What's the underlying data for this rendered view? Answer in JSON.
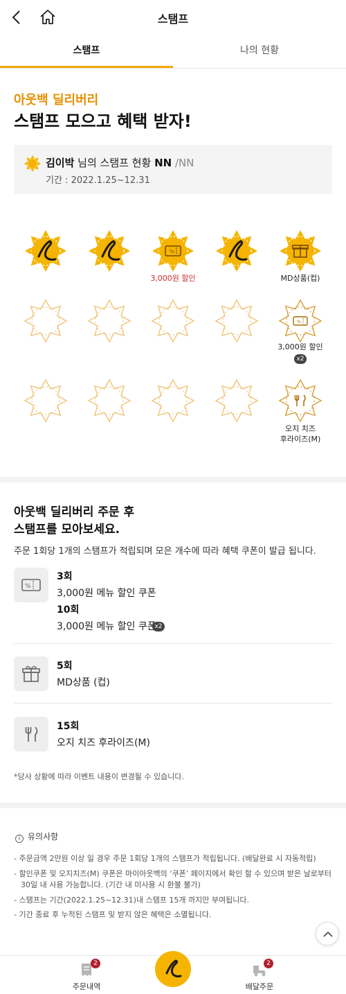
{
  "header": {
    "title": "스탬프"
  },
  "tabs": [
    {
      "label": "스탬프"
    },
    {
      "label": "나의 현황"
    }
  ],
  "hero": {
    "subtitle": "아웃백 딜리버리",
    "title": "스탬프 모으고 혜택 받자!"
  },
  "status": {
    "name": "김이박",
    "middle": " 님의 스탬프 현황 ",
    "count": "NN",
    "total": " /NN",
    "period": "기간 : 2022.1.25~12.31"
  },
  "stamps": {
    "row1_label_3": "3,000원 할인",
    "row1_label_5": "MD상품(컵)",
    "row2_label_5": "3,000원 할인",
    "row2_badge": "x2",
    "row3_label_5_line1": "오지 치즈",
    "row3_label_5_line2": "후라이즈(M)"
  },
  "guide": {
    "title_line1": "아웃백 딜리버리 주문 후",
    "title_line2": "스탬프를 모아보세요.",
    "desc": "주문 1회당 1개의 스탬프가 적립되며 모은 개수에 따라 혜택 쿠폰이 발급 됩니다.",
    "benefits": [
      {
        "count": "3회",
        "text": "3,000원 메뉴 할인 쿠폰"
      },
      {
        "count": "10회",
        "text": "3,000원 메뉴 할인 쿠폰",
        "badge": "x2"
      },
      {
        "count": "5회",
        "text": "MD상품 (컵)"
      },
      {
        "count": "15회",
        "text": "오지 치즈 후라이즈(M)"
      }
    ],
    "notice": "*당사 상황에 따라 이벤트 내용이 변경될 수 있습니다."
  },
  "notes": {
    "title": "유의사항",
    "items": [
      "- 주문금액 2만원 이상 일 경우 주문 1회당 1개의 스탬프가 적립됩니다. (배달완료 시 자동적립)",
      "- 할인쿠폰 및 오지치즈(M) 쿠폰은 마이아웃백의 ‘쿠폰’ 페이지에서 확인 할 수 있으며 받은 날로부터 30일 내 사용 가능합니다. (기간 내 미사용 시 환불 불가)",
      "- 스탬프는 기간(2022.1.25~12.31)내 스탬프 15개 까지만 부여됩니다.",
      "- 기간 종료 후 누적된 스탬프 및 받지 않은 혜택은 소멸됩니다."
    ]
  },
  "bottom_nav": {
    "orders": {
      "label": "주문내역",
      "badge": "2"
    },
    "delivery": {
      "label": "배달주문",
      "badge": "2"
    }
  },
  "colors": {
    "accent": "#f2a900",
    "stamp_fill": "#f5b400",
    "stamp_outline": "#f0c780",
    "sale_label": "#c82c2c"
  }
}
